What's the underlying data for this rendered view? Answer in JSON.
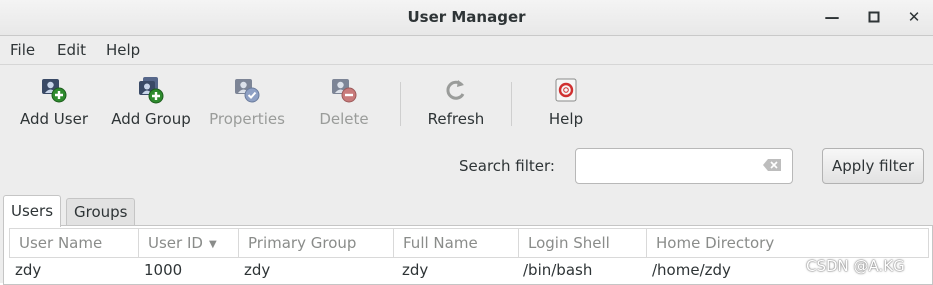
{
  "window": {
    "title": "User Manager"
  },
  "menubar": {
    "items": [
      "File",
      "Edit",
      "Help"
    ]
  },
  "toolbar": {
    "buttons": [
      {
        "label": "Add User",
        "icon": "add-user-icon",
        "enabled": true
      },
      {
        "label": "Add Group",
        "icon": "add-group-icon",
        "enabled": true
      },
      {
        "label": "Properties",
        "icon": "properties-icon",
        "enabled": false
      },
      {
        "label": "Delete",
        "icon": "delete-icon",
        "enabled": false
      },
      {
        "label": "Refresh",
        "icon": "refresh-icon",
        "enabled": true
      },
      {
        "label": "Help",
        "icon": "help-icon",
        "enabled": true
      }
    ]
  },
  "search": {
    "label": "Search filter:",
    "value": "",
    "placeholder": "",
    "apply_label": "Apply filter"
  },
  "tabs": [
    {
      "label": "Users",
      "active": true
    },
    {
      "label": "Groups",
      "active": false
    }
  ],
  "table": {
    "columns": [
      "User Name",
      "User ID",
      "Primary Group",
      "Full Name",
      "Login Shell",
      "Home Directory"
    ],
    "sorted_column": "User ID",
    "rows": [
      [
        "zdy",
        "1000",
        "zdy",
        "zdy",
        "/bin/bash",
        "/home/zdy"
      ]
    ]
  },
  "watermark": "CSDN @A.KG"
}
